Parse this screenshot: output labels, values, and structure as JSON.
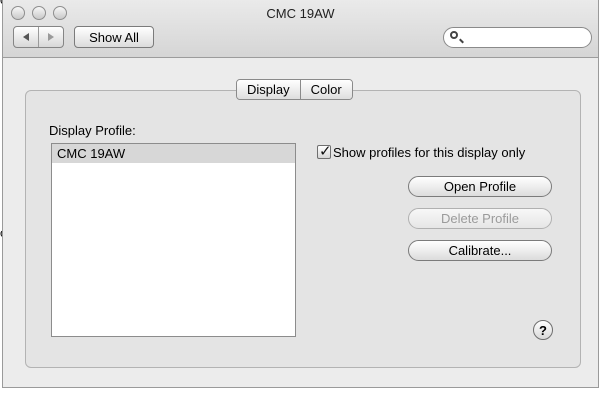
{
  "window": {
    "title": "CMC 19AW"
  },
  "toolbar": {
    "show_all": "Show All",
    "search_placeholder": ""
  },
  "tabs": [
    {
      "label": "Display"
    },
    {
      "label": "Color"
    }
  ],
  "profiles": {
    "section_label": "Display Profile:",
    "items": [
      {
        "name": "CMC 19AW",
        "selected": true
      }
    ],
    "show_only_label": "Show profiles for this display only",
    "show_only_checked": true
  },
  "actions": {
    "open": "Open Profile",
    "delete": "Delete Profile",
    "calibrate": "Calibrate..."
  },
  "help": {
    "label": "?"
  },
  "desktop_fragments": {
    "top": "o",
    "mid": "o"
  },
  "icons": [
    "back-arrow-icon",
    "forward-arrow-icon",
    "search-icon",
    "help-icon",
    "checkmark-icon"
  ]
}
